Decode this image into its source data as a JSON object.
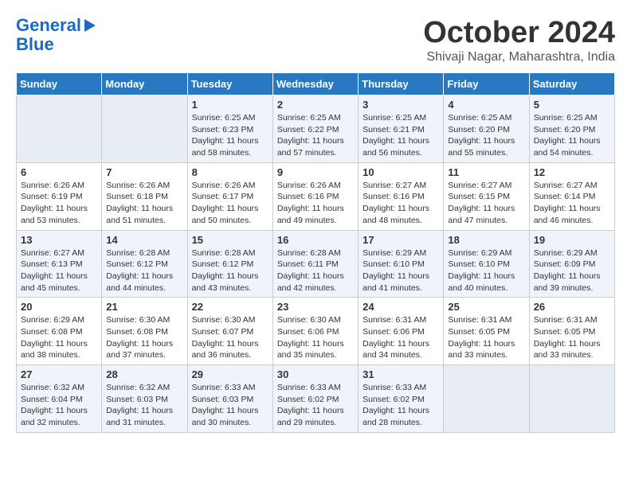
{
  "header": {
    "logo_line1": "General",
    "logo_line2": "Blue",
    "month": "October 2024",
    "location": "Shivaji Nagar, Maharashtra, India"
  },
  "calendar": {
    "days_of_week": [
      "Sunday",
      "Monday",
      "Tuesday",
      "Wednesday",
      "Thursday",
      "Friday",
      "Saturday"
    ],
    "weeks": [
      [
        {
          "day": "",
          "info": ""
        },
        {
          "day": "",
          "info": ""
        },
        {
          "day": "1",
          "info": "Sunrise: 6:25 AM\nSunset: 6:23 PM\nDaylight: 11 hours and 58 minutes."
        },
        {
          "day": "2",
          "info": "Sunrise: 6:25 AM\nSunset: 6:22 PM\nDaylight: 11 hours and 57 minutes."
        },
        {
          "day": "3",
          "info": "Sunrise: 6:25 AM\nSunset: 6:21 PM\nDaylight: 11 hours and 56 minutes."
        },
        {
          "day": "4",
          "info": "Sunrise: 6:25 AM\nSunset: 6:20 PM\nDaylight: 11 hours and 55 minutes."
        },
        {
          "day": "5",
          "info": "Sunrise: 6:25 AM\nSunset: 6:20 PM\nDaylight: 11 hours and 54 minutes."
        }
      ],
      [
        {
          "day": "6",
          "info": "Sunrise: 6:26 AM\nSunset: 6:19 PM\nDaylight: 11 hours and 53 minutes."
        },
        {
          "day": "7",
          "info": "Sunrise: 6:26 AM\nSunset: 6:18 PM\nDaylight: 11 hours and 51 minutes."
        },
        {
          "day": "8",
          "info": "Sunrise: 6:26 AM\nSunset: 6:17 PM\nDaylight: 11 hours and 50 minutes."
        },
        {
          "day": "9",
          "info": "Sunrise: 6:26 AM\nSunset: 6:16 PM\nDaylight: 11 hours and 49 minutes."
        },
        {
          "day": "10",
          "info": "Sunrise: 6:27 AM\nSunset: 6:16 PM\nDaylight: 11 hours and 48 minutes."
        },
        {
          "day": "11",
          "info": "Sunrise: 6:27 AM\nSunset: 6:15 PM\nDaylight: 11 hours and 47 minutes."
        },
        {
          "day": "12",
          "info": "Sunrise: 6:27 AM\nSunset: 6:14 PM\nDaylight: 11 hours and 46 minutes."
        }
      ],
      [
        {
          "day": "13",
          "info": "Sunrise: 6:27 AM\nSunset: 6:13 PM\nDaylight: 11 hours and 45 minutes."
        },
        {
          "day": "14",
          "info": "Sunrise: 6:28 AM\nSunset: 6:12 PM\nDaylight: 11 hours and 44 minutes."
        },
        {
          "day": "15",
          "info": "Sunrise: 6:28 AM\nSunset: 6:12 PM\nDaylight: 11 hours and 43 minutes."
        },
        {
          "day": "16",
          "info": "Sunrise: 6:28 AM\nSunset: 6:11 PM\nDaylight: 11 hours and 42 minutes."
        },
        {
          "day": "17",
          "info": "Sunrise: 6:29 AM\nSunset: 6:10 PM\nDaylight: 11 hours and 41 minutes."
        },
        {
          "day": "18",
          "info": "Sunrise: 6:29 AM\nSunset: 6:10 PM\nDaylight: 11 hours and 40 minutes."
        },
        {
          "day": "19",
          "info": "Sunrise: 6:29 AM\nSunset: 6:09 PM\nDaylight: 11 hours and 39 minutes."
        }
      ],
      [
        {
          "day": "20",
          "info": "Sunrise: 6:29 AM\nSunset: 6:08 PM\nDaylight: 11 hours and 38 minutes."
        },
        {
          "day": "21",
          "info": "Sunrise: 6:30 AM\nSunset: 6:08 PM\nDaylight: 11 hours and 37 minutes."
        },
        {
          "day": "22",
          "info": "Sunrise: 6:30 AM\nSunset: 6:07 PM\nDaylight: 11 hours and 36 minutes."
        },
        {
          "day": "23",
          "info": "Sunrise: 6:30 AM\nSunset: 6:06 PM\nDaylight: 11 hours and 35 minutes."
        },
        {
          "day": "24",
          "info": "Sunrise: 6:31 AM\nSunset: 6:06 PM\nDaylight: 11 hours and 34 minutes."
        },
        {
          "day": "25",
          "info": "Sunrise: 6:31 AM\nSunset: 6:05 PM\nDaylight: 11 hours and 33 minutes."
        },
        {
          "day": "26",
          "info": "Sunrise: 6:31 AM\nSunset: 6:05 PM\nDaylight: 11 hours and 33 minutes."
        }
      ],
      [
        {
          "day": "27",
          "info": "Sunrise: 6:32 AM\nSunset: 6:04 PM\nDaylight: 11 hours and 32 minutes."
        },
        {
          "day": "28",
          "info": "Sunrise: 6:32 AM\nSunset: 6:03 PM\nDaylight: 11 hours and 31 minutes."
        },
        {
          "day": "29",
          "info": "Sunrise: 6:33 AM\nSunset: 6:03 PM\nDaylight: 11 hours and 30 minutes."
        },
        {
          "day": "30",
          "info": "Sunrise: 6:33 AM\nSunset: 6:02 PM\nDaylight: 11 hours and 29 minutes."
        },
        {
          "day": "31",
          "info": "Sunrise: 6:33 AM\nSunset: 6:02 PM\nDaylight: 11 hours and 28 minutes."
        },
        {
          "day": "",
          "info": ""
        },
        {
          "day": "",
          "info": ""
        }
      ]
    ]
  }
}
